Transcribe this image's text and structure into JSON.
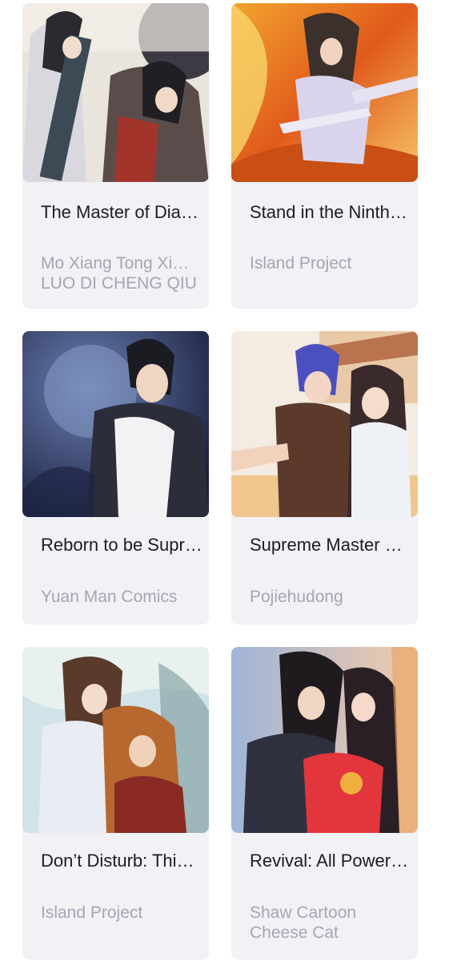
{
  "comics": [
    {
      "title": "The Master of Dia…",
      "authors": [
        "Mo Xiang Tong Xi…",
        "LUO DI CHENG QIU"
      ]
    },
    {
      "title": "Stand in the Ninth…",
      "authors": [
        "Island Project"
      ]
    },
    {
      "title": "Reborn to be Supr…",
      "authors": [
        "Yuan Man Comics"
      ]
    },
    {
      "title": "Supreme Master …",
      "authors": [
        "Pojiehudong"
      ]
    },
    {
      "title": "Don’t Disturb: Thi…",
      "authors": [
        "Island Project"
      ]
    },
    {
      "title": "Revival: All Power…",
      "authors": [
        "Shaw Cartoon",
        "Cheese Cat"
      ]
    }
  ],
  "colors": {
    "card_background": "#f1f1f6",
    "title_text": "#1d1d1f",
    "author_text": "#a5a5b5"
  }
}
